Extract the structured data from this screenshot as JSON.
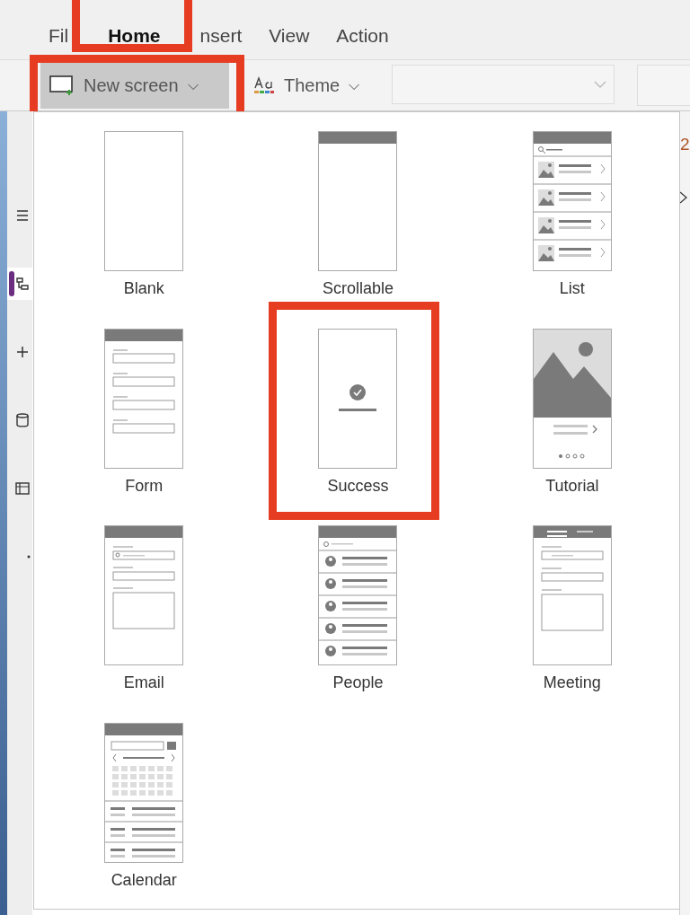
{
  "menu_tabs": [
    {
      "label": "Fil",
      "selected": false,
      "highlighted": false
    },
    {
      "label": "Home",
      "selected": true,
      "highlighted": true
    },
    {
      "label": "nsert",
      "selected": false,
      "highlighted": false
    },
    {
      "label": "View",
      "selected": false,
      "highlighted": false
    },
    {
      "label": "Action",
      "selected": false,
      "highlighted": false
    }
  ],
  "toolbar": {
    "new_screen": {
      "label": "New screen",
      "caret": "⌵",
      "highlighted": true
    },
    "theme": {
      "label": "Theme",
      "caret": "⌵"
    }
  },
  "sidebar": {
    "items": [
      {
        "kind": "menu",
        "selected": false
      },
      {
        "kind": "tree",
        "selected": true
      },
      {
        "kind": "insert",
        "selected": false
      },
      {
        "kind": "data",
        "selected": false
      },
      {
        "kind": "media",
        "selected": false
      },
      {
        "kind": "more",
        "selected": false
      }
    ]
  },
  "right_panel": {
    "count": "2"
  },
  "templates": [
    {
      "label": "Blank",
      "kind": "blank",
      "highlighted": false
    },
    {
      "label": "Scrollable",
      "kind": "scrollable",
      "highlighted": false
    },
    {
      "label": "List",
      "kind": "list",
      "highlighted": false
    },
    {
      "label": "Form",
      "kind": "form",
      "highlighted": false
    },
    {
      "label": "Success",
      "kind": "success",
      "highlighted": true
    },
    {
      "label": "Tutorial",
      "kind": "tutorial",
      "highlighted": false
    },
    {
      "label": "Email",
      "kind": "email",
      "highlighted": false
    },
    {
      "label": "People",
      "kind": "people",
      "highlighted": false
    },
    {
      "label": "Meeting",
      "kind": "meeting",
      "highlighted": false
    },
    {
      "label": "Calendar",
      "kind": "calendar",
      "highlighted": false
    }
  ]
}
